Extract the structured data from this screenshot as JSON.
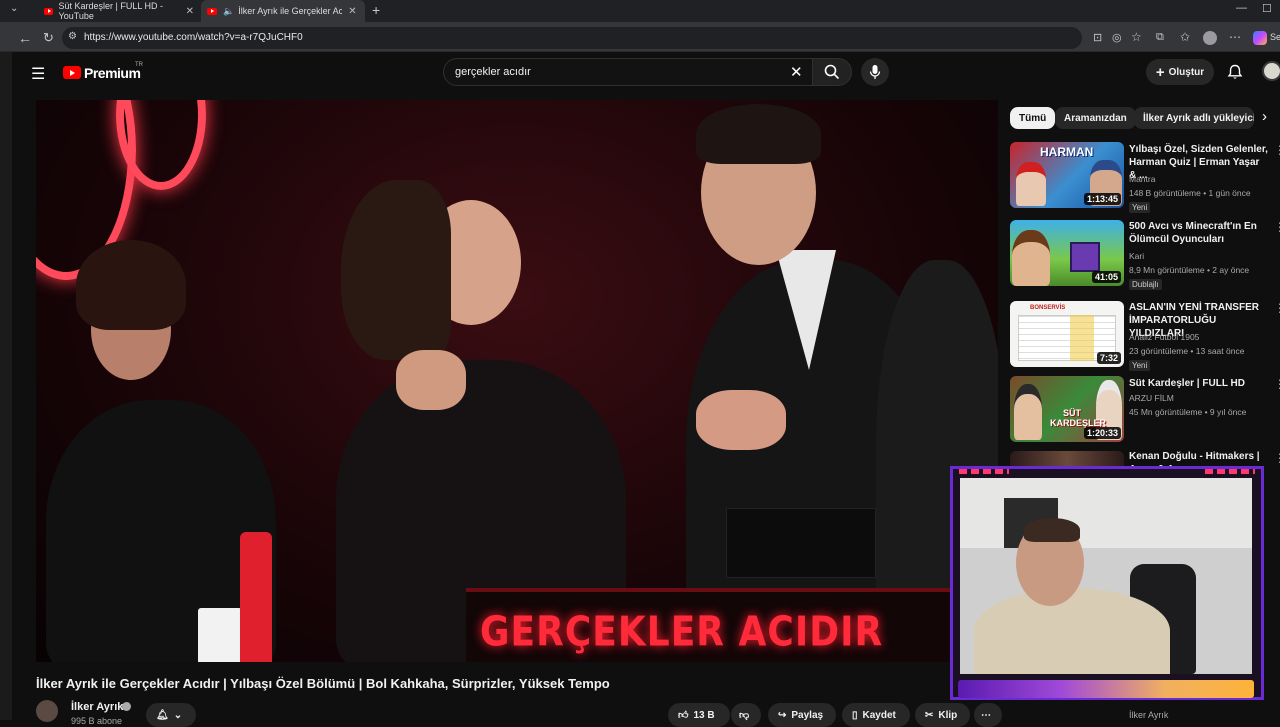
{
  "browser": {
    "tabs": [
      {
        "title": "Süt Kardeşler | FULL HD - YouTube"
      },
      {
        "title": "İlker Ayrık ile Gerçekler Acıdır"
      }
    ],
    "url": "https://www.youtube.com/watch?v=a-r7QJuCHF0",
    "profile_label": "Se"
  },
  "header": {
    "logo_text": "Premium",
    "logo_region": "TR",
    "search_value": "gerçekler acıdır",
    "create_label": "Oluştur"
  },
  "video": {
    "desk_text": "GERÇEKLER ACIDIR",
    "title": "İlker Ayrık ile Gerçekler Acıdır | Yılbaşı Özel Bölümü | Bol Kahkaha, Sürprizler, Yüksek Tempo",
    "channel": "İlker Ayrık",
    "subscribers": "995 B abone",
    "likes": "13 B",
    "share_label": "Paylaş",
    "save_label": "Kaydet",
    "clip_label": "Klip"
  },
  "sidebar": {
    "chips": [
      "Tümü",
      "Aramanızdan",
      "İlker Ayrık adlı yükleyici"
    ],
    "items": [
      {
        "title": "Yılbaşı Özel, Sizden Gelenler, Harman Quiz | Erman Yaşar & ...",
        "channel": "Mantra",
        "meta": "148 B görüntüleme • 1 gün önce",
        "badge": "Yeni",
        "duration": "1:13:45",
        "thumb_text": "HARMAN"
      },
      {
        "title": "500 Avcı vs Minecraft'ın En Ölümcül Oyuncuları",
        "channel": "Kari",
        "meta": "8,9 Mn görüntüleme • 2 ay önce",
        "badge": "Dublajlı",
        "duration": "41:05",
        "thumb_text": ""
      },
      {
        "title": "ASLAN'IN YENİ TRANSFER İMPARATORLUĞU YILDIZLARI",
        "channel": "Analiz Futbol 1905",
        "meta": "23 görüntüleme • 13 saat önce",
        "badge": "Yeni",
        "duration": "7:32",
        "thumb_text": "BONSERVİS"
      },
      {
        "title": "Süt Kardeşler | FULL HD",
        "channel": "ARZU FİLM",
        "meta": "45 Mn görüntüleme • 9 yıl önce",
        "badge": "",
        "duration": "1:20:33",
        "thumb_text": "SÜT KARDEŞLER"
      },
      {
        "title": "Kenan Doğulu - Hitmakers | Arem & Arman",
        "channel": "",
        "meta": "",
        "badge": "",
        "duration": "",
        "thumb_text": ""
      }
    ],
    "bottom_channel": "İlker Ayrık"
  },
  "colors": {
    "accent": "#ff0000",
    "background": "#0f0f0f",
    "webcam_frame": "#6a2bd6"
  }
}
